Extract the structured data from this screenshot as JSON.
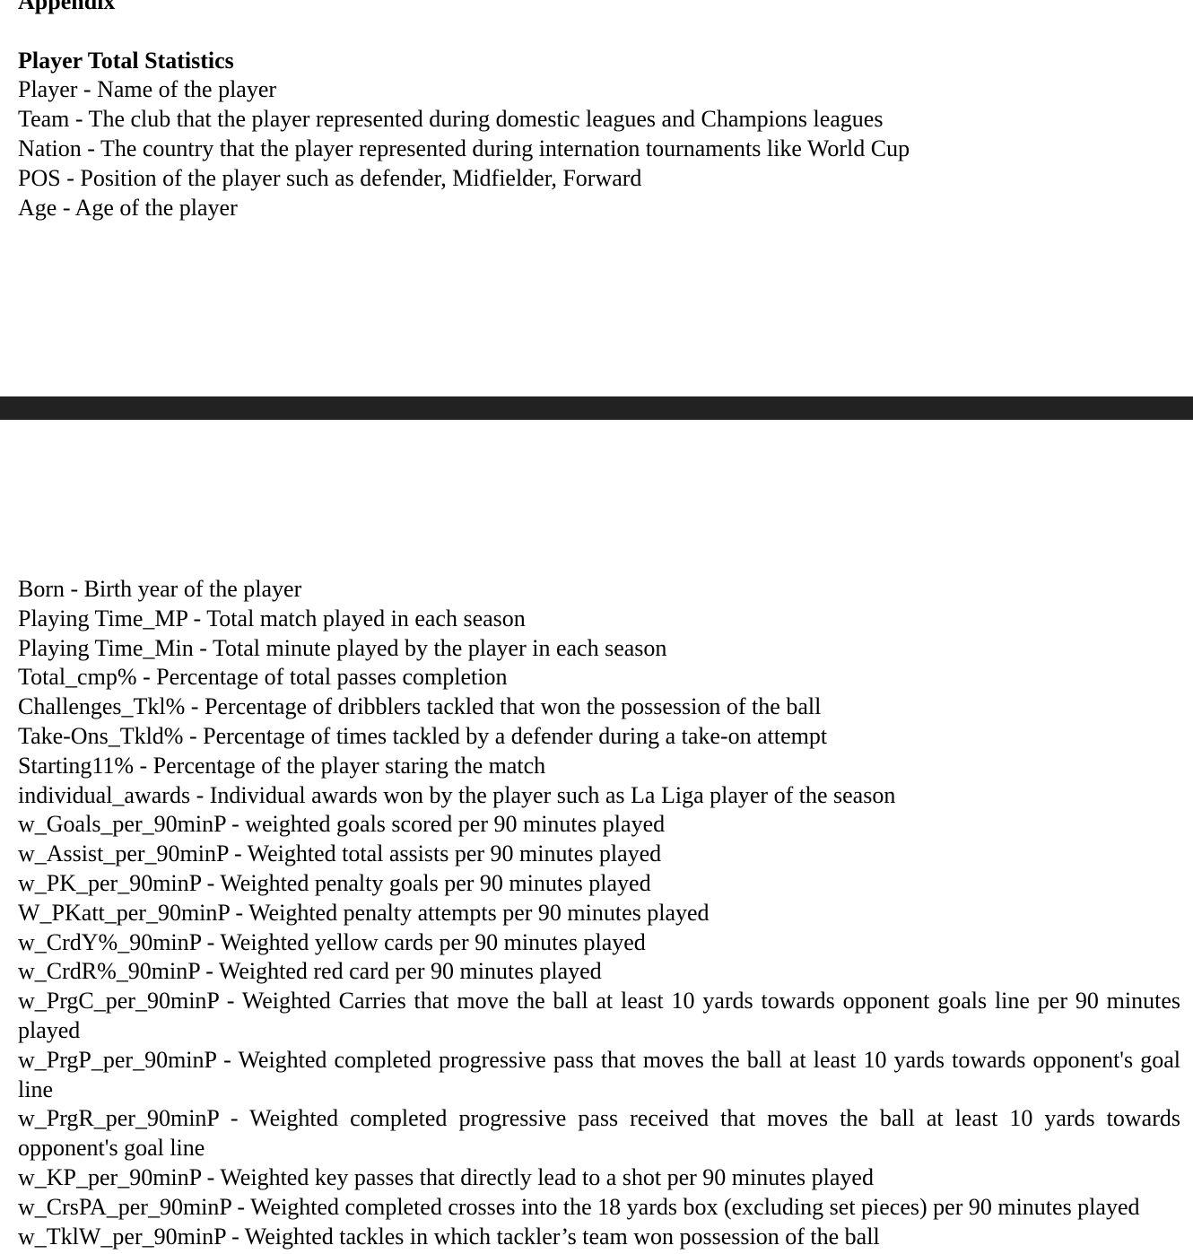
{
  "heading": "Appendix",
  "section_title": "Player Total Statistics",
  "definitions_top": [
    "Player - Name of the player",
    "Team - The club that the player represented during domestic leagues and Champions leagues",
    "Nation - The country that the player represented during internation tournaments like World Cup",
    "POS - Position of the player such as defender, Midfielder, Forward",
    "Age - Age of the player"
  ],
  "definitions_bottom": [
    "Born - Birth year of the player",
    "Playing Time_MP - Total match played in each season",
    "Playing Time_Min - Total minute played by the player in each season",
    "Total_cmp% - Percentage of total passes completion",
    "Challenges_Tkl% - Percentage of dribblers tackled that won the possession of the ball",
    "Take-Ons_Tkld% - Percentage of times tackled by a defender during a take-on attempt",
    "Starting11% - Percentage of the player staring the match",
    "individual_awards - Individual awards won by the player such as La Liga player of the season",
    "w_Goals_per_90minP - weighted goals scored per 90 minutes played",
    "w_Assist_per_90minP - Weighted total assists per 90 minutes played",
    "w_PK_per_90minP - Weighted penalty goals per 90 minutes played",
    "W_PKatt_per_90minP - Weighted penalty attempts per 90 minutes played",
    "w_CrdY%_90minP - Weighted yellow cards per 90 minutes played",
    "w_CrdR%_90minP - Weighted red card per 90 minutes played",
    "w_PrgC_per_90minP - Weighted Carries that move the ball at least 10 yards towards opponent goals line per 90 minutes played",
    "w_PrgP_per_90minP - Weighted completed progressive pass that moves the ball at least 10 yards towards opponent's goal line",
    "w_PrgR_per_90minP - Weighted completed progressive pass received that moves the ball at least 10 yards towards opponent's goal line",
    "w_KP_per_90minP - Weighted key passes that directly lead to a shot per 90 minutes played",
    "w_CrsPA_per_90minP - Weighted completed crosses into the 18 yards box (excluding set pieces) per 90 minutes played",
    "w_TklW_per_90minP - Weighted tackles in which tackler’s team won possession of the ball"
  ]
}
